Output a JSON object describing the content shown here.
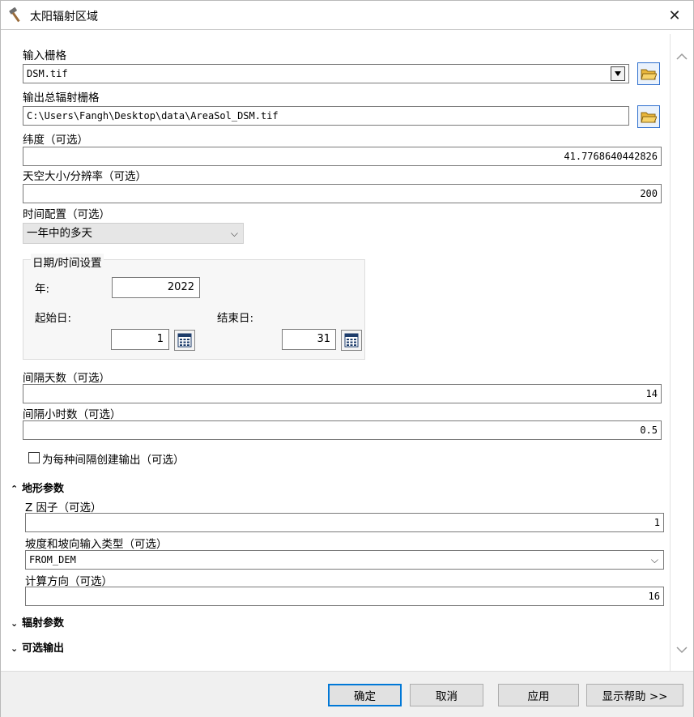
{
  "window": {
    "title": "太阳辐射区域",
    "close_label": "✕"
  },
  "form": {
    "input_raster": {
      "label": "输入栅格",
      "value": "DSM.tif"
    },
    "output_raster": {
      "label": "输出总辐射栅格",
      "value": "C:\\Users\\Fangh\\Desktop\\data\\AreaSol_DSM.tif"
    },
    "latitude": {
      "label": "纬度（可选）",
      "value": "41.7768640442826"
    },
    "sky_size": {
      "label": "天空大小/分辨率（可选）",
      "value": "200"
    },
    "time_config": {
      "label": "时间配置（可选）",
      "value": "一年中的多天"
    },
    "date_group": {
      "title": "日期/时间设置",
      "year_label": "年:",
      "year_value": "2022",
      "start_label": "起始日:",
      "start_value": "1",
      "end_label": "结束日:",
      "end_value": "31"
    },
    "day_interval": {
      "label": "间隔天数（可选）",
      "value": "14"
    },
    "hour_interval": {
      "label": "间隔小时数（可选）",
      "value": "0.5"
    },
    "create_outputs": {
      "label": "为每种间隔创建输出（可选）",
      "checked": false
    },
    "terrain": {
      "header": "地形参数",
      "z_factor": {
        "label": "Z 因子（可选）",
        "value": "1"
      },
      "slope_aspect": {
        "label": "坡度和坡向输入类型（可选）",
        "value": "FROM_DEM"
      },
      "directions": {
        "label": "计算方向（可选）",
        "value": "16"
      }
    },
    "radiation_header": "辐射参数",
    "optional_output_header": "可选输出"
  },
  "buttons": {
    "ok": "确定",
    "cancel": "取消",
    "apply": "应用",
    "help": "显示帮助 >>"
  },
  "colors": {
    "accent": "#0078d7",
    "folder": "#e8b53a"
  }
}
